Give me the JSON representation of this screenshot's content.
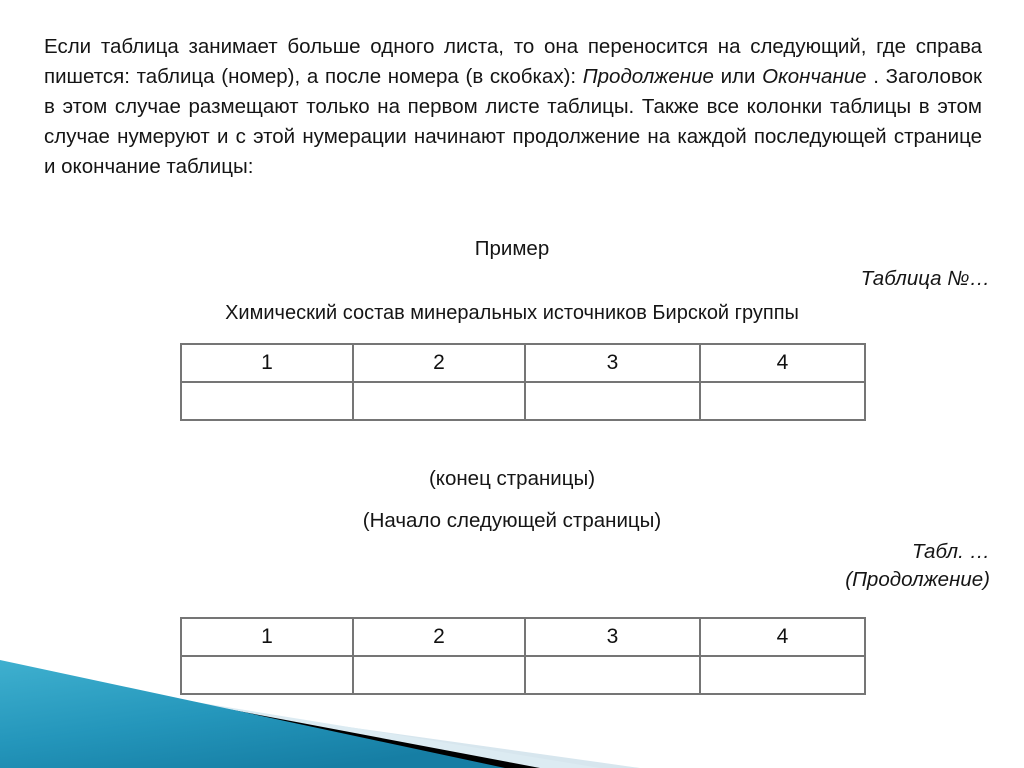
{
  "slide": {
    "background_color": "#ffffff",
    "text_color": "#151515"
  },
  "intro": {
    "part1": "Если таблица занимает больше одного листа, то она переносится на следующий, где справа пишется: таблица (номер), а после номера (в скобках): ",
    "emphasis1": "Продолжение",
    "part2": " или ",
    "emphasis2": "Окончание",
    "part3": " . Заголовок в этом случае размещают только  на первом листе таблицы. Также все колонки таблицы в этом случае нумеруют  и с этой нумерации начинают продолжение на каждой последующей странице и окончание таблицы:"
  },
  "labels": {
    "example": "Пример",
    "table_number_right": "Таблица №…",
    "table_caption": "Химический состав минеральных источников Бирской группы",
    "page_end_note": "(конец страницы)",
    "page_start_note": "(Начало следующей страницы)",
    "continuation_table_number": "Табл. …",
    "continuation_label": "(Продолжение)"
  },
  "example_table": {
    "headers": [
      "1",
      "2",
      "3",
      "4"
    ],
    "rows": [
      [
        "",
        "",
        "",
        ""
      ]
    ]
  },
  "continuation_table": {
    "headers": [
      "1",
      "2",
      "3",
      "4"
    ],
    "rows": [
      [
        "",
        "",
        "",
        ""
      ]
    ]
  },
  "decoration": {
    "name": "diagonal-corner-banner",
    "teal_light": "#3aa6c6",
    "teal_dark": "#1b7fa3",
    "black": "#000000",
    "pale_blue": "#d7e6ee",
    "border_gray": "#757575"
  }
}
